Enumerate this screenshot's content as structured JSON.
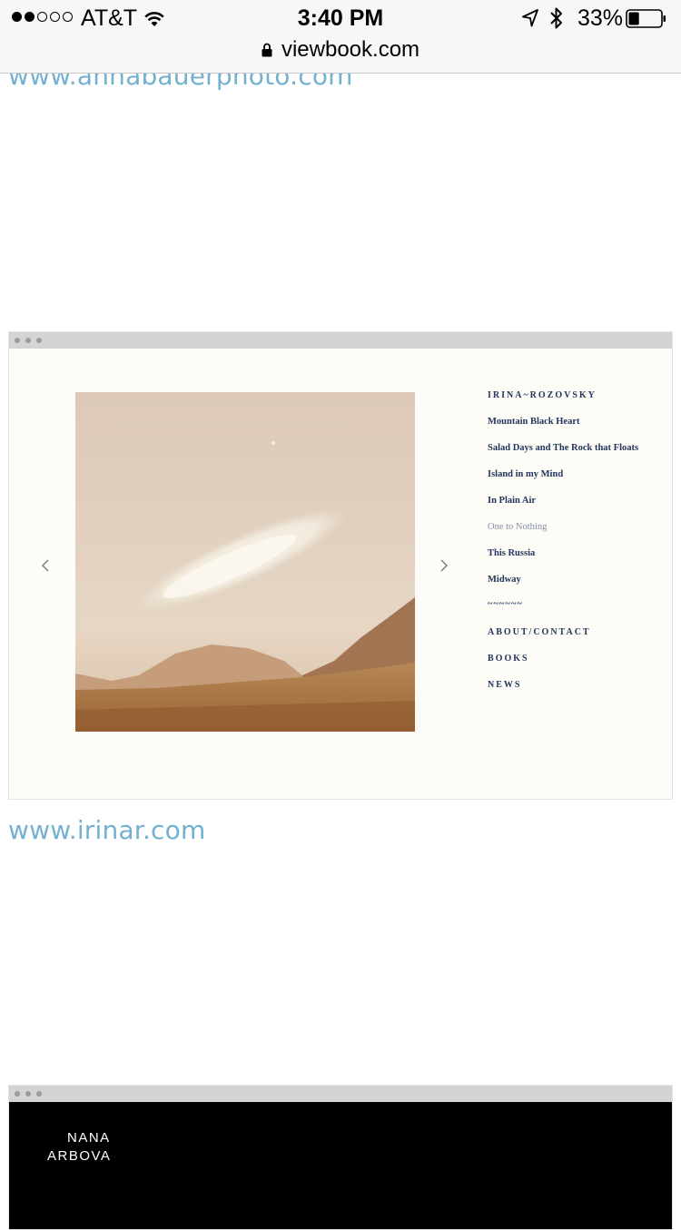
{
  "status_bar": {
    "signal_filled": 2,
    "signal_empty": 3,
    "carrier": "AT&T",
    "time": "3:40 PM",
    "battery_percent": "33%",
    "battery_level": 0.33,
    "icons": [
      "wifi-icon",
      "location-arrow-icon",
      "bluetooth-icon",
      "battery-icon"
    ]
  },
  "browser": {
    "url": "viewbook.com",
    "icon": "lock-icon"
  },
  "content": {
    "link_top": "www.annabauerphoto.com",
    "link_middle": "www.irinar.com",
    "preview_irina": {
      "window_dot_color": "#9b9b9b",
      "background_color": "#fdfcf6",
      "nav_prev_icon": "chevron-left-icon",
      "nav_next_icon": "chevron-right-icon",
      "photo": "desert-mountains-cloud-photo",
      "menu": {
        "title": "IRINA~ROZOVSKY",
        "projects": [
          "Mountain Black Heart",
          "Salad Days and The Rock that Floats",
          "Island in my Mind",
          "In Plain Air",
          "One to Nothing",
          "This Russia",
          "Midway"
        ],
        "active_project": "One to Nothing",
        "divider": "~~~~~~",
        "about_contact": "ABOUT/CONTACT",
        "books": "BOOKS",
        "news": "NEWS",
        "text_color": "#22365e",
        "active_color": "#8291aa"
      }
    },
    "preview_nana": {
      "background_color": "#000000",
      "name_line1": "NANA",
      "name_line2": "ARBOVA"
    },
    "link_color": "#73b1d1"
  }
}
